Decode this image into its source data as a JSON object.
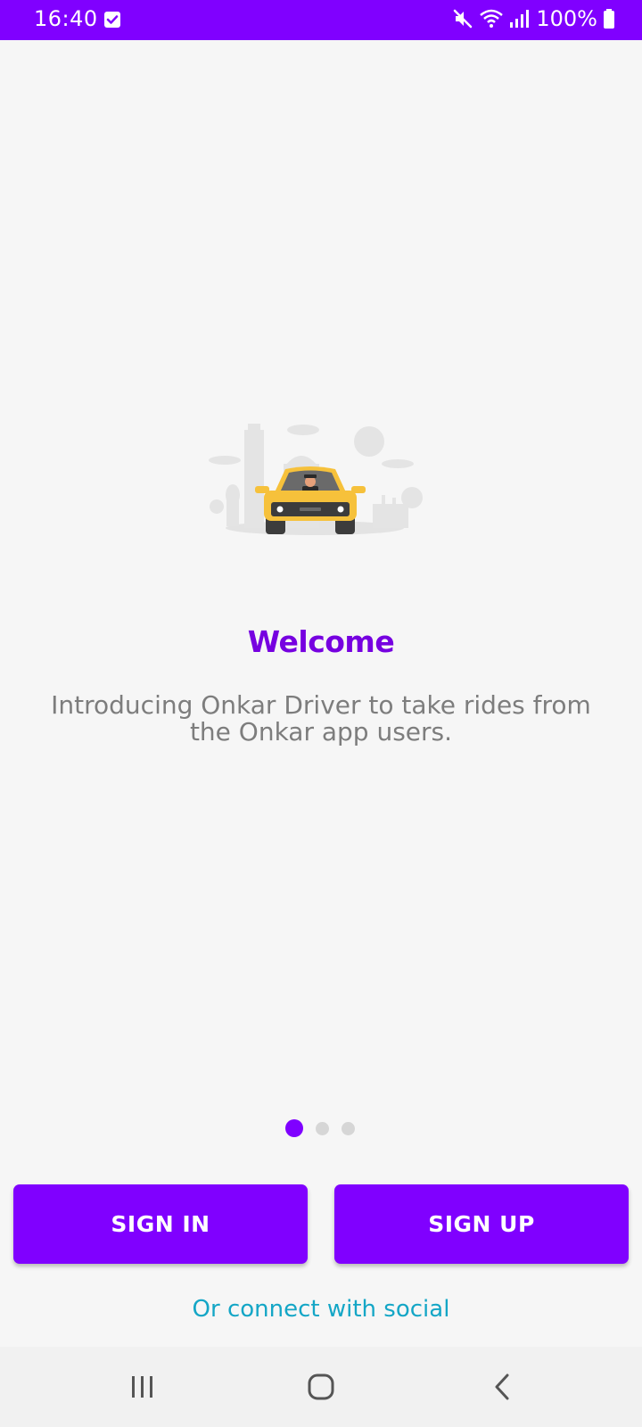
{
  "status_bar": {
    "time": "16:40",
    "battery": "100%",
    "icons": [
      "notification-check-icon",
      "mute-icon",
      "wifi-icon",
      "signal-icon",
      "battery-icon"
    ]
  },
  "welcome": {
    "title": "Welcome",
    "description": "Introducing Onkar Driver to take rides from the Onkar app users."
  },
  "pager": {
    "count": 3,
    "active_index": 0
  },
  "buttons": {
    "sign_in": "SIGN IN",
    "sign_up": "SIGN UP"
  },
  "social_link": "Or connect with social",
  "nav_bar": {
    "icons": [
      "recent-apps-icon",
      "home-icon",
      "back-icon"
    ]
  },
  "colors": {
    "accent": "#8000ff",
    "title": "#7600e0",
    "link": "#14a6c6",
    "taxi": "#f6c13b"
  }
}
